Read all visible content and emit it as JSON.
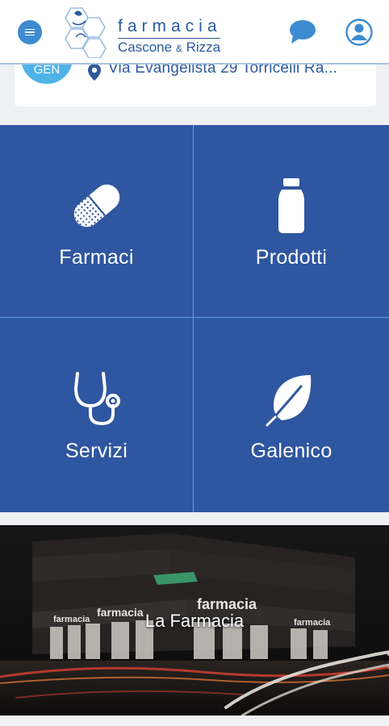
{
  "header": {
    "brand_line1": "farmacia",
    "brand_name_a": "Cascone",
    "brand_amp": "&",
    "brand_name_b": "Rizza"
  },
  "address": {
    "date_badge": "GEN",
    "text": "Via Evangelista 29  Torricelli Ra..."
  },
  "tiles": [
    {
      "label": "Farmaci",
      "icon": "pill-icon"
    },
    {
      "label": "Prodotti",
      "icon": "bottle-icon"
    },
    {
      "label": "Servizi",
      "icon": "stethoscope-icon"
    },
    {
      "label": "Galenico",
      "icon": "leaf-icon"
    }
  ],
  "banner": {
    "title": "La Farmacia",
    "storefront_sign": "farmacia"
  },
  "colors": {
    "tile_bg": "#2f56a0",
    "divider": "#5ea6dc",
    "accent": "#3d8bd1",
    "badge": "#4fb3e8"
  }
}
